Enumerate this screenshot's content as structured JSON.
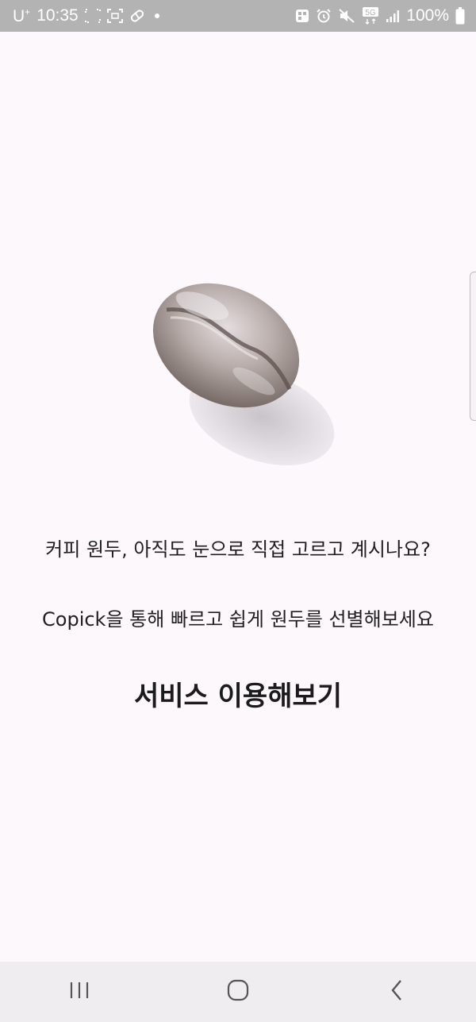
{
  "status_bar": {
    "carrier": "U",
    "carrier_sup": "+",
    "time": "10:35",
    "battery": "100%",
    "network": "5G",
    "icons": [
      "screenshot-icon",
      "screen-record-icon",
      "pill-icon",
      "notification-dot",
      "gallery-icon",
      "alarm-icon",
      "mute-icon",
      "5g-icon",
      "signal-icon",
      "battery-icon"
    ]
  },
  "main": {
    "line1": "커피 원두, 아직도 눈으로 직접 고르고 계시나요?",
    "line2": "Copick을 통해 빠르고 쉽게 원두를 선별해보세요",
    "cta_label": "서비스 이용해보기"
  },
  "nav_bar": {
    "icons": [
      "recent-apps-icon",
      "home-icon",
      "back-icon"
    ]
  },
  "colors": {
    "background": "#fcf8fc",
    "status_bar": "#b3b3b3",
    "nav_bar": "#efedf0"
  }
}
